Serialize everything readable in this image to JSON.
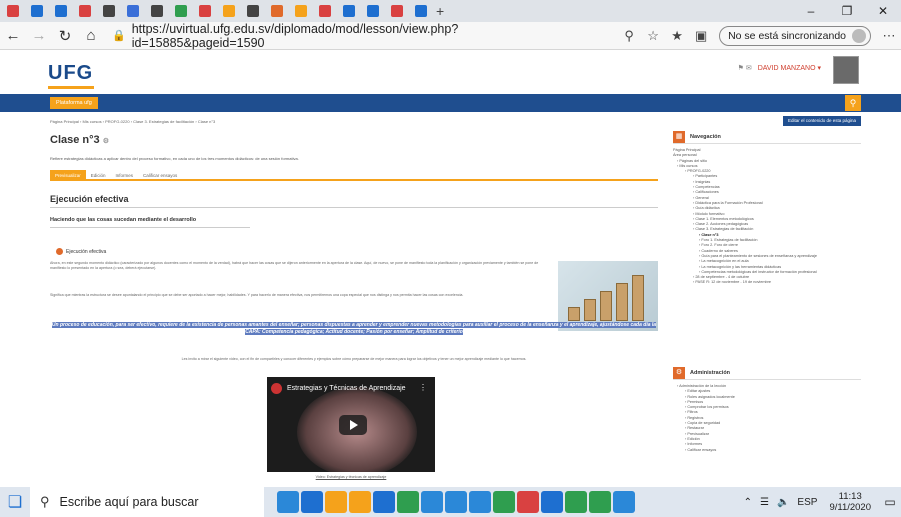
{
  "browser": {
    "tab_colors": [
      "#d94141",
      "#1e6fd0",
      "#1e6fd0",
      "#d94141",
      "#444444",
      "#3a6fd8",
      "#444444",
      "#2f9e4f",
      "#d94141",
      "#f5a21b",
      "#444444",
      "#e06a2b",
      "#f5a21b",
      "#d94141",
      "#1e6fd0",
      "#1e6fd0",
      "#d94141",
      "#1e6fd0"
    ],
    "url": "https://uvirtual.ufg.edu.sv/diplomado/mod/lesson/view.php?id=15885&pageid=1590",
    "sync_label": "No se está sincronizando"
  },
  "site": {
    "logo": "UFG",
    "user_name": "DAVID MANZANO",
    "home_label": "Plataforma ufg",
    "breadcrumbs": "Página Principal  ›  Mis cursos  ›  PROFG-0220  ›  Clase 3. Estrategias de facilitación  ›  Clase n°3",
    "edit_button": "Editar el contenido de esta página"
  },
  "lesson": {
    "title": "Clase n°3",
    "intro": "Refiere estrategias didácticas a aplicar dentro del proceso formativo, en cada uno de los tres momentos didácticos: de una sesión formativa.",
    "tabs": [
      "Previsualizar",
      "Edición",
      "Informes",
      "Calificar ensayos"
    ],
    "section_title": "Ejecución efectiva",
    "subheading": "Haciendo que las cosas sucedan mediante el desarrollo",
    "bullet_label": "Ejecución efectiva",
    "para1": "Ahora, en este segundo momento didáctico (caracterizado por algunos docentes como el momento de la verdad), habrá que hacer las cosas que se dijeron anteriormente en la apertura de la clase. Aquí, de nuevo, se pone de manifiesto toda la planificación y organización previamente y también se pone de manifiesto lo presentado en la apertura (o sea, deberá ejecutarse).",
    "para2": "Significa que mientras la estructura se desee apuntalando el principio que se debe ser aportado a hacer mejor, habilidades. Y para hacerlo de manera efectiva, nos permitiremos una copa especial que nos distinga y nos permita hacer las cosas con excelencia.",
    "quote": "Un proceso de educación, para ser efectivo, requiere de la existencia de personas amantes del enseñar; personas dispuestas a aprender y emprender nuevas metodologías para auxiliar el proceso de la enseñanza y el aprendizaje, ajustándose cada día la CAPA: Competencia pedagógica; Actitud docente; Pasión por enseñar; Amplitud de criterio",
    "note": "Les invito a mirar el siguiente video, con el fin de compartirles y conocer diferentes y ejemplos sobre cómo prepararse de mejor manera para lograr los objetivos y tener un mejor aprendizaje mediante lo que hacemos.",
    "video_title": "Estrategias y Técnicas de Aprendizaje",
    "video_caption": "Video: Estrategias y técnicas de aprendizaje"
  },
  "navigation": {
    "title": "Navegación",
    "items": [
      {
        "t": "Página Principal",
        "d": 0
      },
      {
        "t": "Área personal",
        "d": 0
      },
      {
        "t": "Páginas del sitio",
        "d": 1
      },
      {
        "t": "Mis cursos",
        "d": 1
      },
      {
        "t": "PROFG-0220",
        "d": 2
      },
      {
        "t": "Participantes",
        "d": 3
      },
      {
        "t": "Insignias",
        "d": 3
      },
      {
        "t": "Competencias",
        "d": 3
      },
      {
        "t": "Calificaciones",
        "d": 3
      },
      {
        "t": "General",
        "d": 3
      },
      {
        "t": "Didáctica para la Formación Profesional",
        "d": 3
      },
      {
        "t": "Guía didáctica",
        "d": 3
      },
      {
        "t": "Módulo formativo",
        "d": 3
      },
      {
        "t": "Clase 1. Elementos metodológicos",
        "d": 3
      },
      {
        "t": "Clase 2. Acciones pedagógicas",
        "d": 3
      },
      {
        "t": "Clase 3. Estrategias de facilitación",
        "d": 3
      },
      {
        "t": "Clase n°3",
        "d": 4,
        "cur": true
      },
      {
        "t": "Foro 1. Estrategias de facilitación",
        "d": 4
      },
      {
        "t": "Foro 2. Foro de cierre",
        "d": 4
      },
      {
        "t": "Cuaderno de saberes",
        "d": 4
      },
      {
        "t": "Guía para el planteamiento de sesiones de enseñanza y aprendizaje",
        "d": 4
      },
      {
        "t": "La metacognición en el aula",
        "d": 4
      },
      {
        "t": "La metacognición y las herramientas didácticas",
        "d": 4
      },
      {
        "t": "Competencias metodológicas del instructor de formación profesional",
        "d": 4
      },
      {
        "t": "28 de septiembre - 4 de octubre",
        "d": 3
      },
      {
        "t": "PASE R: 12 de noviembre - 19 de noviembre",
        "d": 3
      }
    ]
  },
  "admin": {
    "title": "Administración",
    "items": [
      {
        "t": "Administración de la lección",
        "d": 1
      },
      {
        "t": "Editar ajustes",
        "d": 2
      },
      {
        "t": "Roles asignados localmente",
        "d": 2
      },
      {
        "t": "Permisos",
        "d": 2
      },
      {
        "t": "Comprobar los permisos",
        "d": 2
      },
      {
        "t": "Filtros",
        "d": 2
      },
      {
        "t": "Registros",
        "d": 2
      },
      {
        "t": "Copia de seguridad",
        "d": 2
      },
      {
        "t": "Restaurar",
        "d": 2
      },
      {
        "t": "Previsualizar",
        "d": 2
      },
      {
        "t": "Edición",
        "d": 2
      },
      {
        "t": "Informes",
        "d": 2
      },
      {
        "t": "Calificar ensayos",
        "d": 2
      }
    ]
  },
  "taskbar": {
    "search_placeholder": "Escribe aquí para buscar",
    "app_colors": [
      "#2b88d8",
      "#1e6fd0",
      "#f5a21b",
      "#f5a21b",
      "#1e6fd0",
      "#2f9e4f",
      "#2b88d8",
      "#2b88d8",
      "#2b88d8",
      "#2f9e4f",
      "#d94141",
      "#1e6fd0",
      "#2f9e4f",
      "#2f9e4f",
      "#2b88d8"
    ],
    "lang": "ESP",
    "time": "11:13",
    "date": "9/11/2020"
  }
}
